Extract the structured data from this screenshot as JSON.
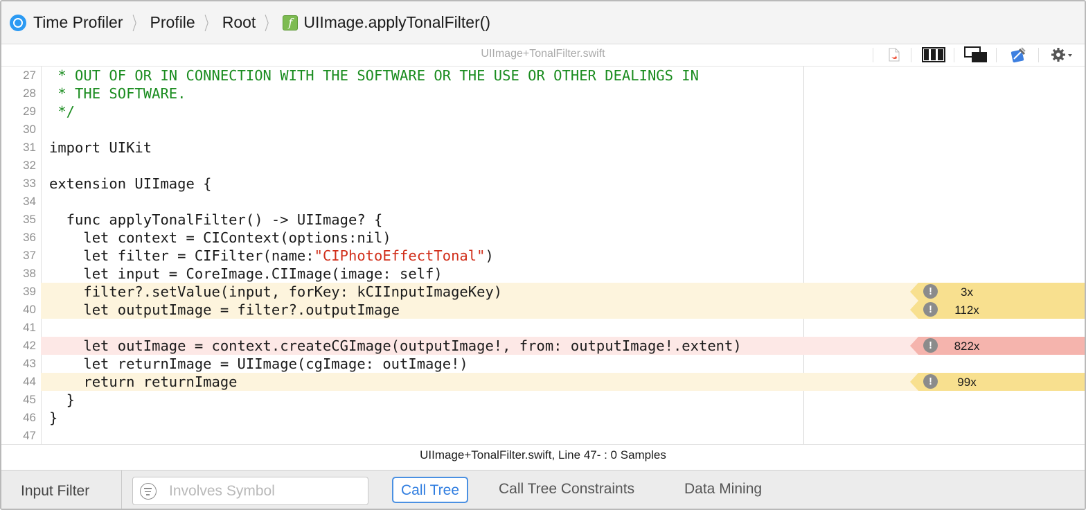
{
  "breadcrumb": {
    "app_name": "Time Profiler",
    "items": [
      "Profile",
      "Root"
    ],
    "function_name": "UIImage.applyTonalFilter()",
    "function_icon_glyph": "f"
  },
  "file_header": {
    "title": "UIImage+TonalFilter.swift",
    "icons": [
      "swift-file-icon",
      "split-columns-icon",
      "overlapping-windows-icon",
      "xcode-icon",
      "gear-menu-icon"
    ]
  },
  "code": {
    "lines": [
      {
        "number": "27",
        "segments": [
          {
            "text": " * OUT OF OR IN CONNECTION WITH THE SOFTWARE OR THE USE OR OTHER DEALINGS IN",
            "kind": "comment"
          }
        ]
      },
      {
        "number": "28",
        "segments": [
          {
            "text": " * THE SOFTWARE.",
            "kind": "comment"
          }
        ]
      },
      {
        "number": "29",
        "segments": [
          {
            "text": " */",
            "kind": "comment"
          }
        ]
      },
      {
        "number": "30",
        "segments": [
          {
            "text": "",
            "kind": "plain"
          }
        ]
      },
      {
        "number": "31",
        "segments": [
          {
            "text": "import UIKit",
            "kind": "plain"
          }
        ]
      },
      {
        "number": "32",
        "segments": [
          {
            "text": "",
            "kind": "plain"
          }
        ]
      },
      {
        "number": "33",
        "segments": [
          {
            "text": "extension UIImage {",
            "kind": "plain"
          }
        ]
      },
      {
        "number": "34",
        "segments": [
          {
            "text": "",
            "kind": "plain"
          }
        ]
      },
      {
        "number": "35",
        "segments": [
          {
            "text": "  func applyTonalFilter() -> UIImage? {",
            "kind": "plain"
          }
        ]
      },
      {
        "number": "36",
        "segments": [
          {
            "text": "    let context = CIContext(options:nil)",
            "kind": "plain"
          }
        ]
      },
      {
        "number": "37",
        "segments": [
          {
            "text": "    let filter = CIFilter(name:",
            "kind": "plain"
          },
          {
            "text": "\"CIPhotoEffectTonal\"",
            "kind": "string"
          },
          {
            "text": ")",
            "kind": "plain"
          }
        ]
      },
      {
        "number": "38",
        "segments": [
          {
            "text": "    let input = CoreImage.CIImage(image: self)",
            "kind": "plain"
          }
        ]
      },
      {
        "number": "39",
        "segments": [
          {
            "text": "    filter?.setValue(input, forKey: kCIInputImageKey)",
            "kind": "plain"
          }
        ],
        "highlight": "warn",
        "count": "3x"
      },
      {
        "number": "40",
        "segments": [
          {
            "text": "    let outputImage = filter?.outputImage",
            "kind": "plain"
          }
        ],
        "highlight": "warn",
        "count": "112x"
      },
      {
        "number": "41",
        "segments": [
          {
            "text": "",
            "kind": "plain"
          }
        ]
      },
      {
        "number": "42",
        "segments": [
          {
            "text": "    let outImage = context.createCGImage(outputImage!, from: outputImage!.extent)",
            "kind": "plain"
          }
        ],
        "highlight": "hot",
        "count": "822x"
      },
      {
        "number": "43",
        "segments": [
          {
            "text": "    let returnImage = UIImage(cgImage: outImage!)",
            "kind": "plain"
          }
        ]
      },
      {
        "number": "44",
        "segments": [
          {
            "text": "    return returnImage",
            "kind": "plain"
          }
        ],
        "highlight": "warn",
        "count": "99x"
      },
      {
        "number": "45",
        "segments": [
          {
            "text": "  }",
            "kind": "plain"
          }
        ]
      },
      {
        "number": "46",
        "segments": [
          {
            "text": "}",
            "kind": "plain"
          }
        ]
      },
      {
        "number": "47",
        "segments": [
          {
            "text": "",
            "kind": "plain"
          }
        ]
      }
    ],
    "badge_icon_glyph": "!"
  },
  "status": {
    "text": "UIImage+TonalFilter.swift, Line 47- : 0 Samples"
  },
  "bottom_bar": {
    "input_filter_label": "Input Filter",
    "search_placeholder": "Involves Symbol",
    "search_value": "",
    "tabs": [
      "Call Tree",
      "Call Tree Constraints",
      "Data Mining"
    ],
    "active_tab": "Call Tree"
  },
  "colors": {
    "comment": "#1a8c1f",
    "string": "#d12f1b",
    "warn_line": "#fdf4dd",
    "warn_badge": "#f8e08f",
    "hot_line": "#fde8e6",
    "hot_badge": "#f5b4ad",
    "accent": "#4a90e2"
  }
}
